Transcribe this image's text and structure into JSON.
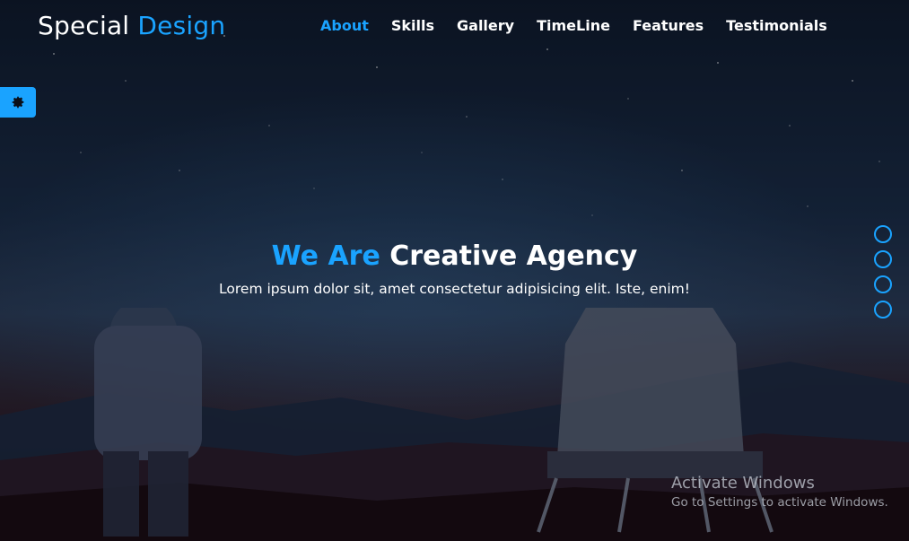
{
  "header": {
    "logo_part1": "Special",
    "logo_part2": "Design",
    "nav": [
      {
        "label": "About",
        "active": true
      },
      {
        "label": "Skills"
      },
      {
        "label": "Gallery"
      },
      {
        "label": "TimeLine"
      },
      {
        "label": "Features"
      },
      {
        "label": "Testimonials"
      }
    ]
  },
  "hero": {
    "title_accent": "We Are",
    "title_rest": "Creative Agency",
    "subtitle": "Lorem ipsum dolor sit, amet consectetur adipisicing elit. Iste, enim!"
  },
  "settings": {
    "icon": "gear-icon"
  },
  "bullets": {
    "count": 4
  },
  "watermark": {
    "title": "Activate Windows",
    "subtitle": "Go to Settings to activate Windows."
  },
  "colors": {
    "accent": "#1aa3ff",
    "text": "#ffffff"
  }
}
